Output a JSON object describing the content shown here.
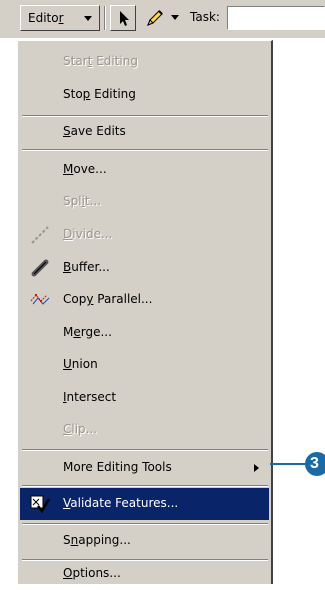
{
  "toolbar": {
    "editor_label": "Editor",
    "task_label": "Task:"
  },
  "menu": {
    "items": [
      {
        "label": "Start Editing",
        "enabled": false
      },
      {
        "label": "Stop Editing",
        "enabled": true
      },
      {
        "label": "Save Edits",
        "enabled": true
      },
      {
        "label": "Move...",
        "enabled": true
      },
      {
        "label": "Split...",
        "enabled": false
      },
      {
        "label": "Divide...",
        "enabled": false,
        "icon": "divide-icon"
      },
      {
        "label": "Buffer...",
        "enabled": true,
        "icon": "buffer-icon"
      },
      {
        "label": "Copy Parallel...",
        "enabled": true,
        "icon": "copy-parallel-icon"
      },
      {
        "label": "Merge...",
        "enabled": true
      },
      {
        "label": "Union",
        "enabled": true
      },
      {
        "label": "Intersect",
        "enabled": true
      },
      {
        "label": "Clip...",
        "enabled": false
      },
      {
        "label": "More Editing Tools",
        "enabled": true,
        "submenu": true
      },
      {
        "label": "Validate Features...",
        "enabled": true,
        "highlighted": true,
        "icon": "validate-icon"
      },
      {
        "label": "Snapping...",
        "enabled": true
      },
      {
        "label": "Options...",
        "enabled": true
      }
    ]
  },
  "callout": {
    "number": "3",
    "color": "#1b6aa6"
  },
  "colors": {
    "menu_bg": "#d4d0c8",
    "highlight": "#0a246a"
  }
}
